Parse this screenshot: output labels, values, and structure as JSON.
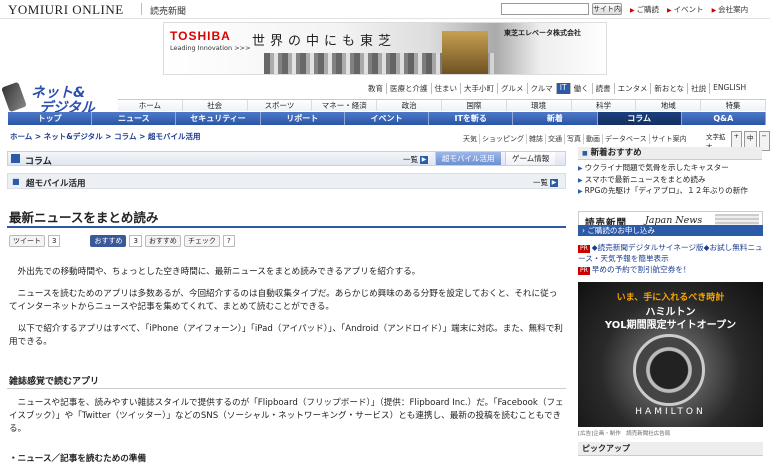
{
  "header": {
    "logo": "YOMIURI ONLINE",
    "paper": "読売新聞",
    "search_button": "サイト内",
    "links": [
      "ご購読",
      "イベント",
      "会社案内"
    ]
  },
  "banner": {
    "brand": "TOSHIBA",
    "tagline": "Leading Innovation >>>",
    "copy": "世界の中にも東芝",
    "company": "東芝エレベータ株式会社"
  },
  "section_logo": [
    "ネット&",
    "デジタル"
  ],
  "categories": [
    "教育",
    "医療と介護",
    "住まい",
    "大手小町",
    "グルメ",
    "クルマ",
    "IT",
    "働く",
    "読書",
    "エンタメ",
    "新おとな",
    "社説",
    "ENGLISH"
  ],
  "nav1": [
    "ホーム",
    "社会",
    "スポーツ",
    "マネー・経済",
    "政治",
    "国際",
    "環境",
    "科学",
    "地域",
    "特集"
  ],
  "nav2": [
    "トップ",
    "ニュース",
    "セキュリティー",
    "リポート",
    "イベント",
    "ITを斬る",
    "新着",
    "コラム",
    "Q&A"
  ],
  "breadcrumb": "ホーム > ネット&デジタル > コラム > 超モバイル活用",
  "tools": [
    "天気",
    "ショッピング",
    "雑誌",
    "交通",
    "写真",
    "動画",
    "データベース",
    "サイト案内"
  ],
  "font_size": {
    "label": "文字拡大",
    "buttons": [
      "+",
      "中",
      "−"
    ]
  },
  "column": {
    "title": "コラム",
    "list_label": "一覧",
    "tabs": [
      "超モバイル活用",
      "ゲーム情報"
    ],
    "sub_title": "超モバイル活用"
  },
  "article": {
    "title": "最新ニュースをまとめ読み",
    "tweet": "ツイート",
    "tweet_count": "3",
    "fb_like": "おすすめ",
    "fb_count": "3",
    "mixi": "おすすめ",
    "check": "チェック",
    "check_count": "?",
    "paragraphs": [
      "外出先での移動時間や、ちょっとした空き時間に、最新ニュースをまとめ読みできるアプリを紹介する。",
      "ニュースを読むためのアプリは多数あるが、今回紹介するのは自動収集タイプだ。あらかじめ興味のある分野を設定しておくと、それに従ってインターネットからニュースや記事を集めてくれて、まとめて読むことができる。",
      "以下で紹介するアプリはすべて、「iPhone（アイフォーン）」「iPad（アイパッド）」、「Android（アンドロイド）」端末に対応。また、無料で利用できる。"
    ],
    "subheading": "雑誌感覚で読むアプリ",
    "paragraph2": "ニュースや記事を、読みやすい雑誌スタイルで提供するのが「Flipboard（フリップボード）」（提供：Flipboard Inc.）だ。「Facebook（フェイスブック）」や「Twitter（ツイッター）」などのSNS（ソーシャル・ネットワーキング・サービス）とも連携し、最新の投稿を読むこともできる。",
    "bullet": "・ニュース／記事を読むための準備"
  },
  "sidebar": {
    "new_heading": "新着おすすめ",
    "new_items": [
      "ウクライナ問題で気骨を示したキャスター",
      "スマホで最新ニュースをまとめ読み",
      "RPGの先駆け「ディアブロ」、１２年ぶりの新作"
    ],
    "yjn_a": "読売新聞",
    "yjn_b": "Japan News",
    "subscribe": "ご購読のお申し込み",
    "promo": [
      {
        "tag": "PR",
        "text": "◆読売新聞デジタルサイネージ版◆お試し無料ニュース・天気予報を簡単表示"
      },
      {
        "tag": "PR",
        "text": "早めの予約で割引航空券を！"
      }
    ],
    "ad": {
      "line1": "いま、手に入れるべき時計",
      "line2": "ハミルトン",
      "line3": "YOL期間限定サイトオープン",
      "brand": "HAMILTON",
      "note": "[広告]企画・制作　読売新聞社広告局"
    },
    "pickup": "ピックアップ"
  }
}
